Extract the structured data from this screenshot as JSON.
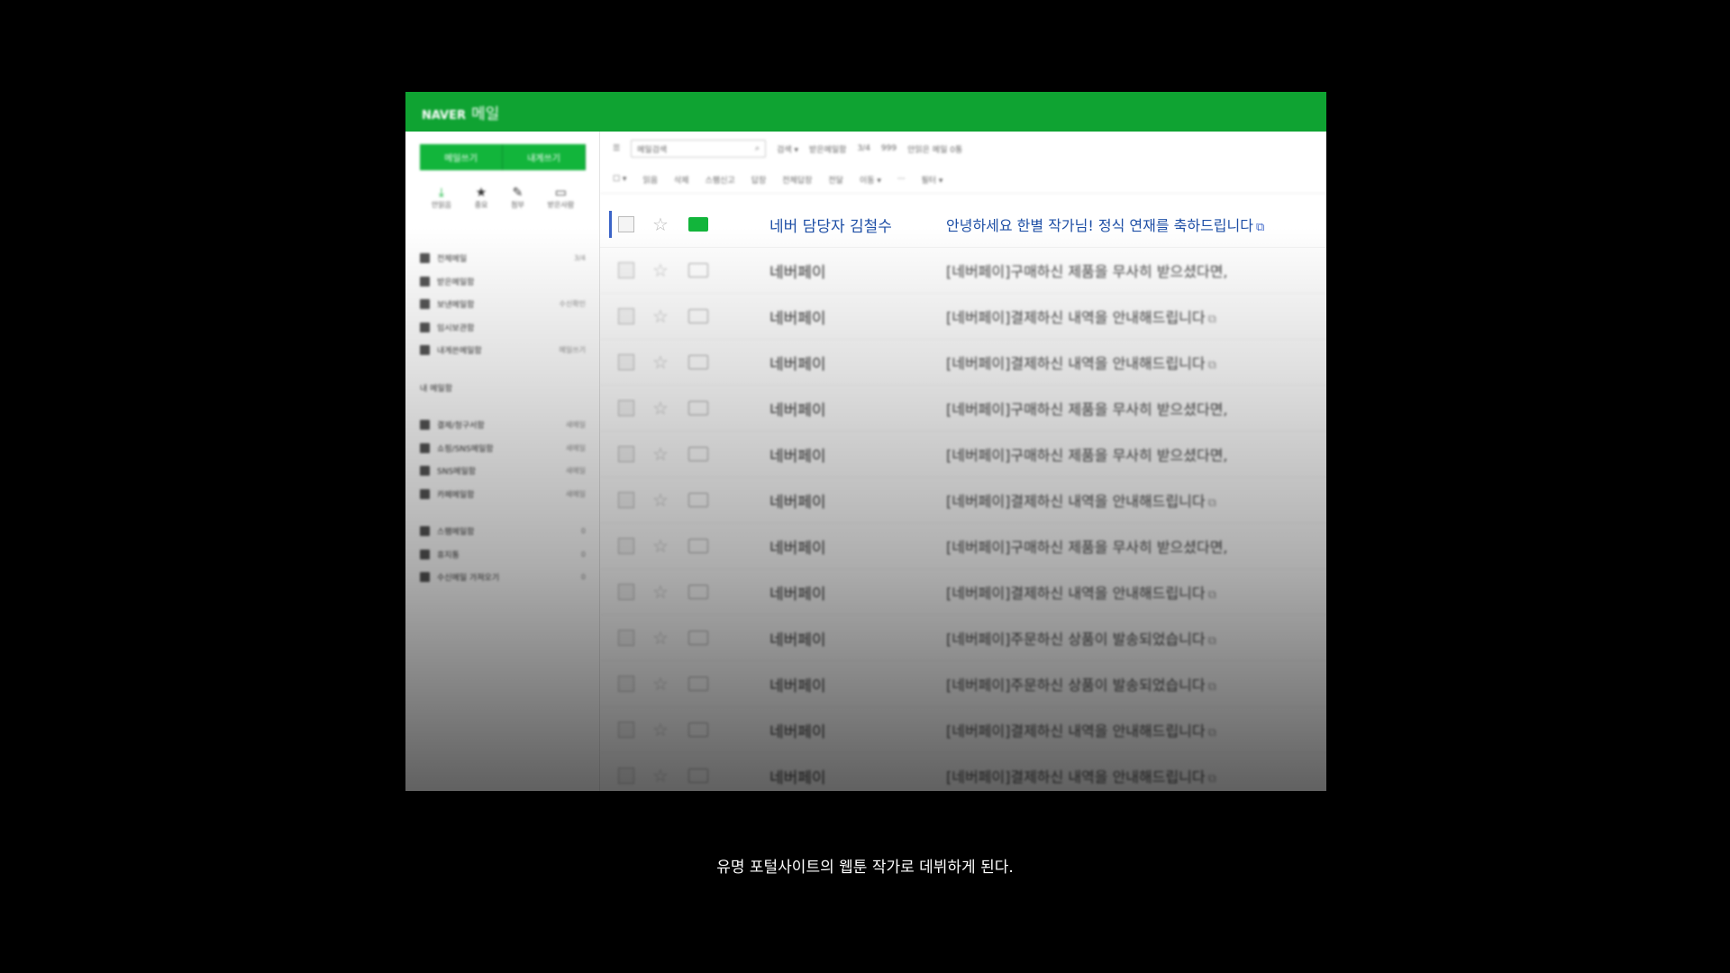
{
  "app": {
    "brand": "NAVER",
    "title": "메일"
  },
  "sidebar": {
    "buttons": [
      "메일쓰기",
      "내게쓰기"
    ],
    "quick": [
      {
        "icon": "download-icon",
        "glyph": "⤓",
        "label": "안읽음"
      },
      {
        "icon": "star-icon",
        "glyph": "★",
        "label": "중요"
      },
      {
        "icon": "attach-icon",
        "glyph": "✎",
        "label": "첨부"
      },
      {
        "icon": "mail-icon",
        "glyph": "▭",
        "label": "받은사람"
      }
    ],
    "folders": [
      {
        "icon": "inbox-icon",
        "label": "전체메일",
        "count": "3/4"
      },
      {
        "icon": "inbox-icon",
        "label": "받은메일함",
        "count": ""
      },
      {
        "icon": "send-icon",
        "label": "보낸메일함",
        "count": "수신확인"
      },
      {
        "icon": "folder-icon",
        "label": "임시보관함",
        "count": ""
      },
      {
        "icon": "inbox-icon",
        "label": "내게쓴메일함",
        "count": "메일쓰기"
      }
    ],
    "my_folders_label": "내 메일함",
    "extra_folders": [
      {
        "icon": "inbox-icon",
        "label": "결제/청구서함",
        "count": "새메일"
      },
      {
        "icon": "gear-icon",
        "label": "쇼핑/SNS메일함",
        "count": "새메일"
      },
      {
        "icon": "share-icon",
        "label": "SNS메일함",
        "count": "새메일"
      },
      {
        "icon": "inbox-icon",
        "label": "카페메일함",
        "count": "새메일"
      }
    ],
    "bottom_folders": [
      {
        "icon": "spam-icon",
        "label": "스팸메일함",
        "count": "0"
      },
      {
        "icon": "trash-icon",
        "label": "휴지통",
        "count": "0"
      },
      {
        "icon": "mail-icon",
        "label": "수신메일 가져오기",
        "count": "0"
      }
    ]
  },
  "toolbar": {
    "search_placeholder": "메일검색",
    "items": [
      "검색 ▾",
      "받은메일함",
      "3/4",
      "999",
      "안읽은 메일 0통"
    ],
    "actions": [
      "☐ ▾",
      "읽음",
      "삭제",
      "스팸신고",
      "답장",
      "전체답장",
      "전달",
      "이동 ▾",
      "···",
      "필터 ▾"
    ]
  },
  "emails": [
    {
      "sender": "네버 담당자 김철수",
      "subject": "안녕하세요 한별 작가님! 정식 연재를 축하드립니다",
      "ext": true,
      "unread": true
    },
    {
      "sender": "네버페이",
      "subject": "[네버페이]구매하신 제품을 무사히 받으셨다면,",
      "ext": false
    },
    {
      "sender": "네버페이",
      "subject": "[네버페이]결제하신 내역을 안내해드립니다",
      "ext": true
    },
    {
      "sender": "네버페이",
      "subject": "[네버페이]결제하신 내역을 안내해드립니다",
      "ext": true
    },
    {
      "sender": "네버페이",
      "subject": "[네버페이]구매하신 제품을 무사히 받으셨다면,",
      "ext": false
    },
    {
      "sender": "네버페이",
      "subject": "[네버페이]구매하신 제품을 무사히 받으셨다면,",
      "ext": false
    },
    {
      "sender": "네버페이",
      "subject": "[네버페이]결제하신 내역을 안내해드립니다",
      "ext": true
    },
    {
      "sender": "네버페이",
      "subject": "[네버페이]구매하신 제품을 무사히 받으셨다면,",
      "ext": false
    },
    {
      "sender": "네버페이",
      "subject": "[네버페이]결제하신 내역을 안내해드립니다",
      "ext": true
    },
    {
      "sender": "네버페이",
      "subject": "[네버페이]주문하신 상품이 발송되었습니다",
      "ext": true
    },
    {
      "sender": "네버페이",
      "subject": "[네버페이]주문하신 상품이 발송되었습니다",
      "ext": true
    },
    {
      "sender": "네버페이",
      "subject": "[네버페이]결제하신 내역을 안내해드립니다",
      "ext": true
    },
    {
      "sender": "네버페이",
      "subject": "[네버페이]결제하신 내역을 안내해드립니다",
      "ext": true
    }
  ],
  "caption": "유명 포털사이트의 웹툰 작가로 데뷔하게 된다.",
  "colors": {
    "brand_green": "#0fa332",
    "link_blue": "#1e4fa6"
  }
}
